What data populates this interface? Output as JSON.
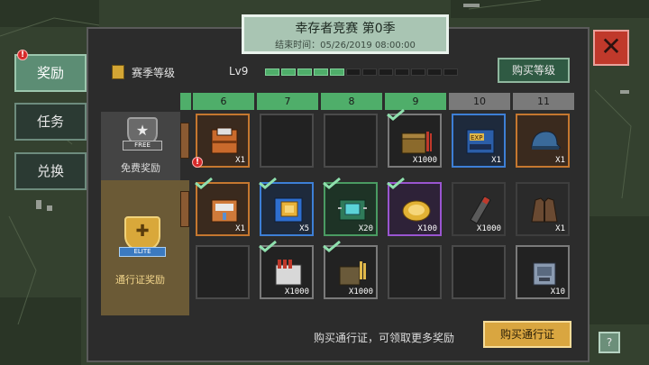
{
  "title": "幸存者竞赛 第0季",
  "end_time": "结束时间：05/26/2019 08:00:00",
  "close_glyph": "✕",
  "tabs": [
    {
      "label": "奖励",
      "active": true,
      "alert": true
    },
    {
      "label": "任务",
      "active": false,
      "alert": false
    },
    {
      "label": "兑换",
      "active": false,
      "alert": false
    }
  ],
  "season": {
    "label": "赛季等级",
    "level": "Lv9",
    "progress_segments_filled": 5,
    "progress_segments_total": 12,
    "buy_level_label": "购买等级"
  },
  "columns": [
    "6",
    "7",
    "8",
    "9",
    "10",
    "11"
  ],
  "columns_unlocked": 4,
  "free_track": {
    "badge_text": "FREE",
    "label": "免费奖励",
    "rewards": [
      {
        "column": "6",
        "qty": "X1",
        "claimed": false,
        "alert": true,
        "icon": "supply-crate-icon"
      },
      {
        "column": "7",
        "qty": "",
        "claimed": false,
        "icon": ""
      },
      {
        "column": "8",
        "qty": "",
        "claimed": false,
        "icon": ""
      },
      {
        "column": "9",
        "qty": "X1000",
        "claimed": true,
        "icon": "ammo-box-icon"
      },
      {
        "column": "10",
        "qty": "X1",
        "claimed": false,
        "icon": "exp-card-icon"
      },
      {
        "column": "11",
        "qty": "X1",
        "claimed": false,
        "icon": "cap-icon"
      }
    ]
  },
  "elite_track": {
    "badge_text": "ELITE",
    "label": "通行证奖励",
    "rewards_row1": [
      {
        "column": "6",
        "qty": "X1",
        "claimed": true,
        "icon": "medkit-crate-icon"
      },
      {
        "column": "7",
        "qty": "X5",
        "claimed": true,
        "icon": "blueprint-icon"
      },
      {
        "column": "8",
        "qty": "X20",
        "claimed": true,
        "icon": "circuit-icon"
      },
      {
        "column": "9",
        "qty": "X100",
        "claimed": true,
        "icon": "gold-coin-icon"
      },
      {
        "column": "10",
        "qty": "X1000",
        "claimed": false,
        "icon": "rocket-ammo-icon"
      },
      {
        "column": "11",
        "qty": "X1",
        "claimed": false,
        "icon": "jacket-icon"
      }
    ],
    "rewards_row2": [
      {
        "column": "6",
        "qty": "",
        "claimed": false,
        "icon": ""
      },
      {
        "column": "7",
        "qty": "X1000",
        "claimed": true,
        "icon": "shell-box-icon"
      },
      {
        "column": "8",
        "qty": "X1000",
        "claimed": true,
        "icon": "bullet-pack-icon"
      },
      {
        "column": "9",
        "qty": "",
        "claimed": false,
        "icon": ""
      },
      {
        "column": "10",
        "qty": "",
        "claimed": false,
        "icon": ""
      },
      {
        "column": "11",
        "qty": "X10",
        "claimed": false,
        "icon": "machine-part-icon"
      }
    ]
  },
  "hint": "购买通行证，可领取更多奖励",
  "buy_pass_label": "购买通行证",
  "corner_glyph": "?",
  "colors": {
    "accent_green": "#4fae6a",
    "gold": "#d9a640",
    "close_red": "#c0392b"
  }
}
